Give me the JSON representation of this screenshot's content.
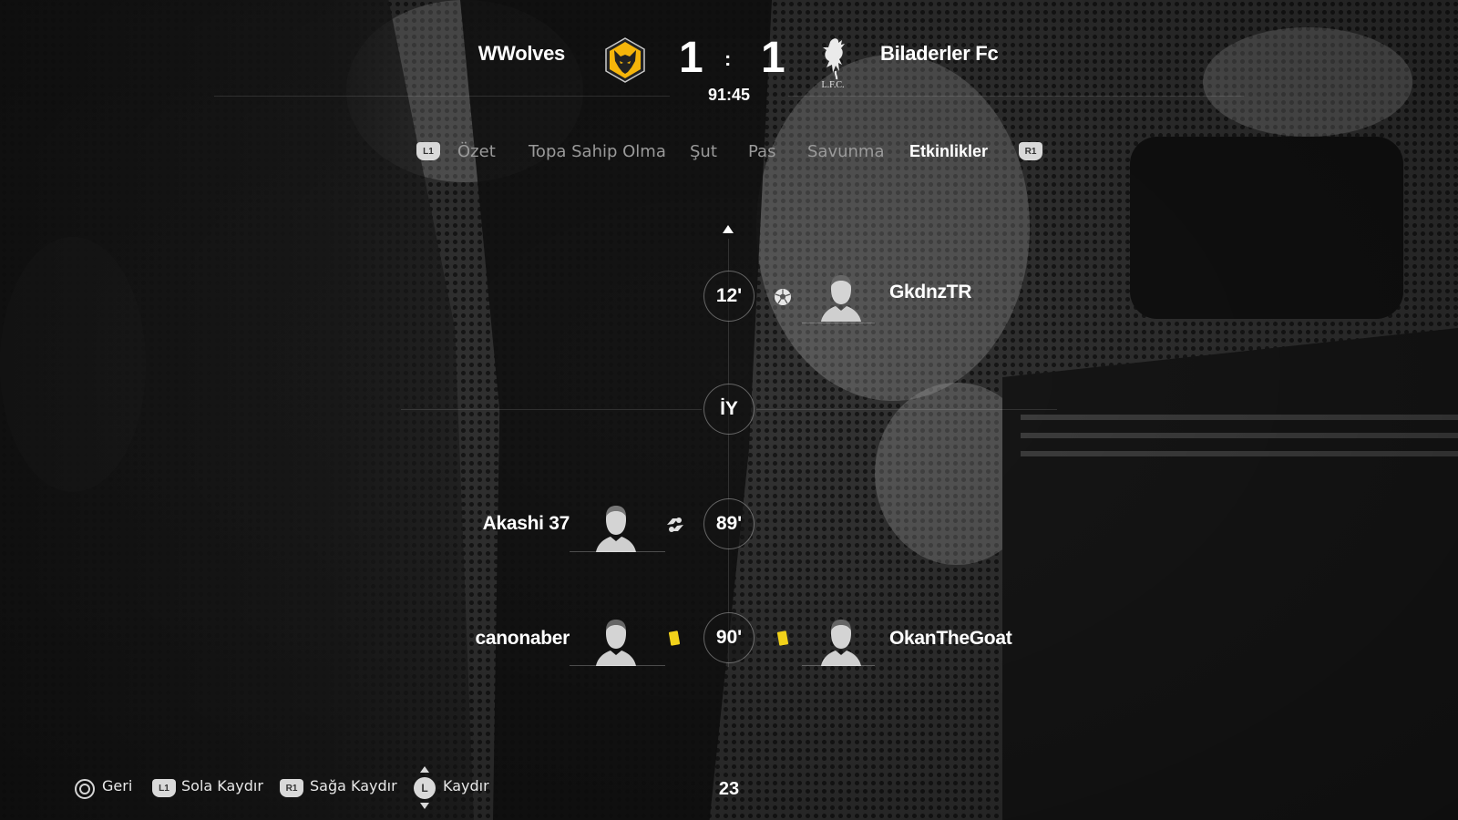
{
  "match": {
    "home_team": "WWolves",
    "away_team": "Biladerler Fc",
    "home_score": "1",
    "away_score": "1",
    "separator": ":",
    "clock": "91:45",
    "away_crest_text": "L.F.C."
  },
  "tabs": {
    "prev_button": "L1",
    "next_button": "R1",
    "items": [
      "Özet",
      "Topa Sahip Olma",
      "Şut",
      "Pas",
      "Savunma",
      "Etkinlikler"
    ],
    "active": "Etkinlikler"
  },
  "timeline": {
    "events": [
      {
        "minute": "12'",
        "side": "away",
        "player": "GkdnzTR",
        "icon": "goal-ball-icon"
      },
      {
        "minute": "İY",
        "side": "none",
        "label": "half-time-marker"
      },
      {
        "minute": "89'",
        "side": "home",
        "player": "Akashi 37",
        "icon": "substitution-icon"
      },
      {
        "minute": "90'",
        "side": "both",
        "home_player": "canonaber",
        "away_player": "OkanTheGoat",
        "icon": "yellow-card-icon"
      }
    ]
  },
  "footer": {
    "back": {
      "button": "circle",
      "label": "Geri"
    },
    "scroll_left": {
      "button": "L1",
      "label": "Sola Kaydır"
    },
    "scroll_right": {
      "button": "R1",
      "label": "Sağa Kaydır"
    },
    "scroll": {
      "button": "L",
      "label": "Kaydır"
    },
    "page_number": "23"
  },
  "colors": {
    "wolves_gold": "#f5b50a",
    "wolves_dark": "#222222",
    "yellow_card": "#f2d21a",
    "tab_inactive": "#9a9a9a",
    "text": "#ffffff"
  }
}
